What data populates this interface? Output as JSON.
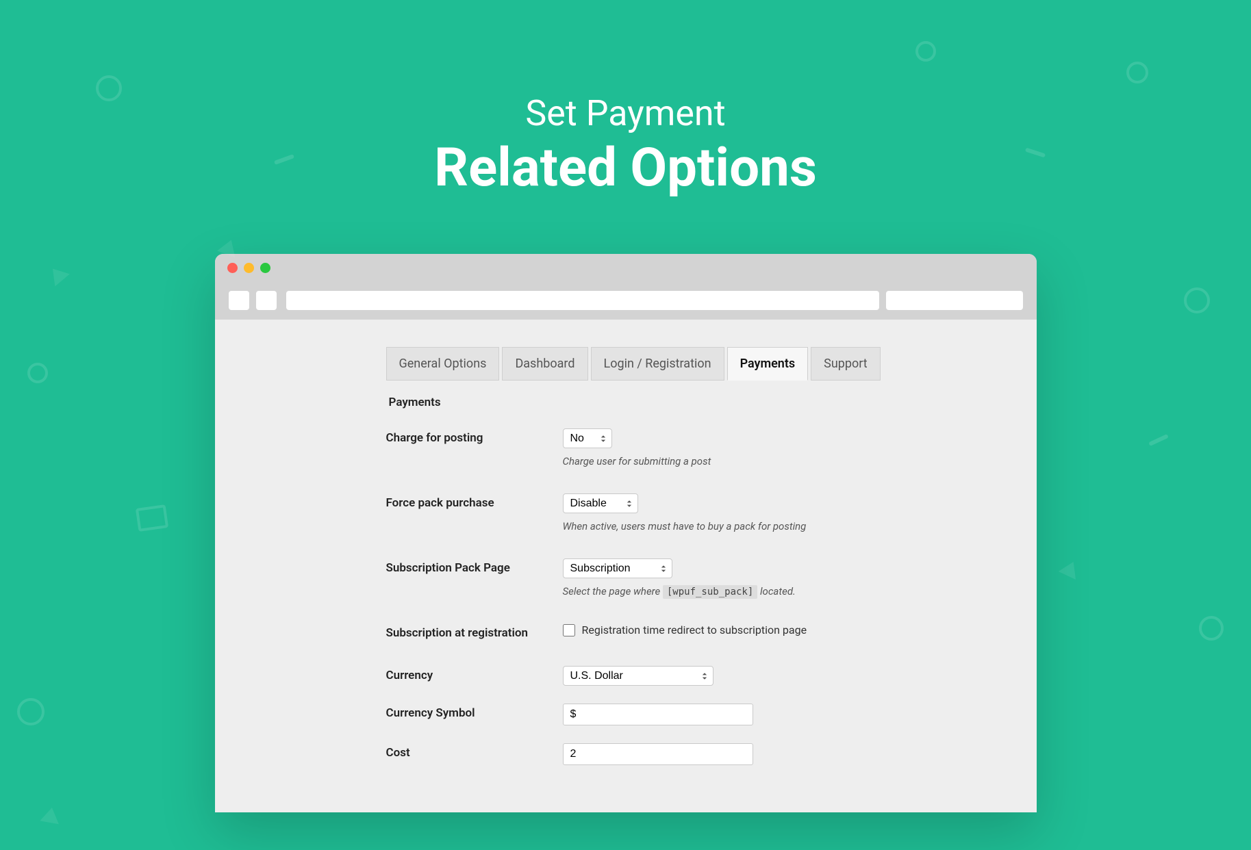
{
  "hero": {
    "subtitle": "Set Payment",
    "title": "Related Options"
  },
  "tabs": [
    {
      "label": "General Options",
      "active": false
    },
    {
      "label": "Dashboard",
      "active": false
    },
    {
      "label": "Login / Registration",
      "active": false
    },
    {
      "label": "Payments",
      "active": true
    },
    {
      "label": "Support",
      "active": false
    }
  ],
  "section_title": "Payments",
  "fields": {
    "charge": {
      "label": "Charge for posting",
      "value": "No",
      "help": "Charge user for submitting a post"
    },
    "force_pack": {
      "label": "Force pack purchase",
      "value": "Disable",
      "help": "When active, users must have to buy a pack for posting"
    },
    "sub_page": {
      "label": "Subscription Pack Page",
      "value": "Subscription",
      "help_prefix": "Select the page where ",
      "help_code": "[wpuf_sub_pack]",
      "help_suffix": " located."
    },
    "sub_reg": {
      "label": "Subscription at registration",
      "checkbox_label": "Registration time redirect to subscription page"
    },
    "currency": {
      "label": "Currency",
      "value": "U.S. Dollar"
    },
    "currency_symbol": {
      "label": "Currency Symbol",
      "value": "$"
    },
    "cost": {
      "label": "Cost",
      "value": "2"
    }
  }
}
